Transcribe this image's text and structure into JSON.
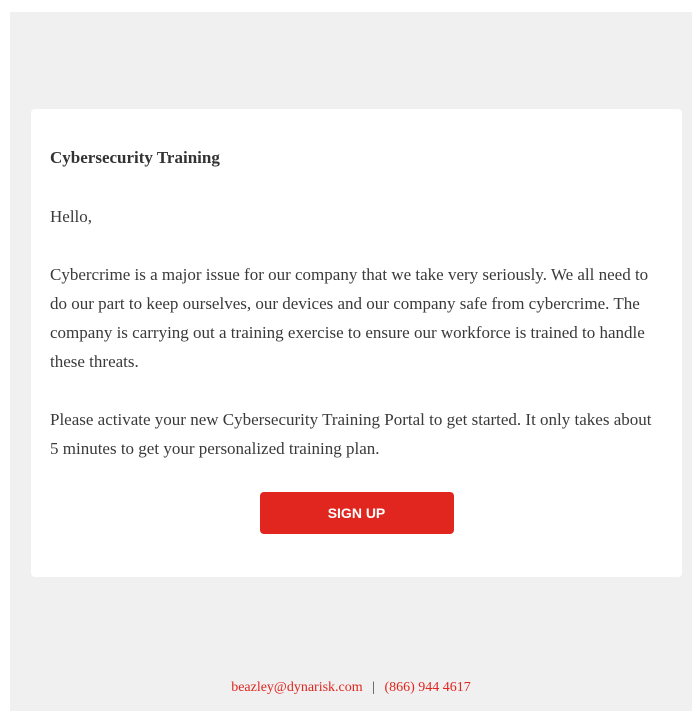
{
  "email": {
    "title": "Cybersecurity Training",
    "greeting": "Hello,",
    "paragraph1": "Cybercrime is a major issue for our company that we take very seriously. We all need to do our part to keep ourselves, our devices and our company safe from cybercrime. The company is carrying out a training exercise to ensure our workforce is trained to handle these threats.",
    "paragraph2": "Please activate your new Cybersecurity Training Portal to get started. It only takes about 5 minutes to get your personalized training plan.",
    "button_label": "SIGN UP"
  },
  "footer": {
    "email": "beazley@dynarisk.com",
    "separator": "|",
    "phone": "(866) 944 4617"
  },
  "colors": {
    "accent": "#e0261f",
    "background": "#f0f0f0",
    "card": "#ffffff"
  }
}
